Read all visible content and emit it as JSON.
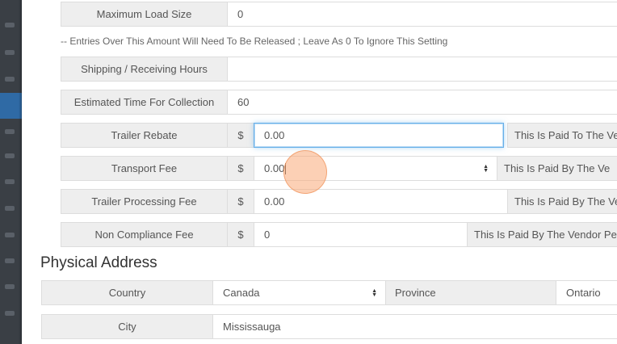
{
  "form": {
    "max_load": {
      "label": "Maximum Load Size",
      "value": "0"
    },
    "note": "-- Entries Over This Amount Will Need To Be Released ; Leave As 0 To Ignore This Setting",
    "hours": {
      "label": "Shipping / Receiving Hours",
      "value": ""
    },
    "collection_time": {
      "label": "Estimated Time For Collection",
      "value": "60"
    },
    "trailer_rebate": {
      "label": "Trailer Rebate",
      "currency": "$",
      "value": "0.00",
      "note": "This Is Paid To The Ve"
    },
    "transport_fee": {
      "label": "Transport Fee",
      "currency": "$",
      "value": "0.00",
      "note": "This Is Paid By The Ve"
    },
    "trailer_processing_fee": {
      "label": "Trailer Processing Fee",
      "currency": "$",
      "value": "0.00",
      "note": "This Is Paid By The Ve"
    },
    "non_compliance_fee": {
      "label": "Non Compliance Fee",
      "currency": "$",
      "value": "0",
      "note": "This Is Paid By The Vendor Per"
    }
  },
  "address": {
    "title": "Physical Address",
    "country": {
      "label": "Country",
      "value": "Canada"
    },
    "province": {
      "label": "Province",
      "value": "Ontario"
    },
    "city": {
      "label": "City",
      "value": "Mississauga"
    }
  },
  "icons": {
    "select_arrows": "updown-arrows-icon",
    "spinner": "spinner-arrows-icon"
  }
}
